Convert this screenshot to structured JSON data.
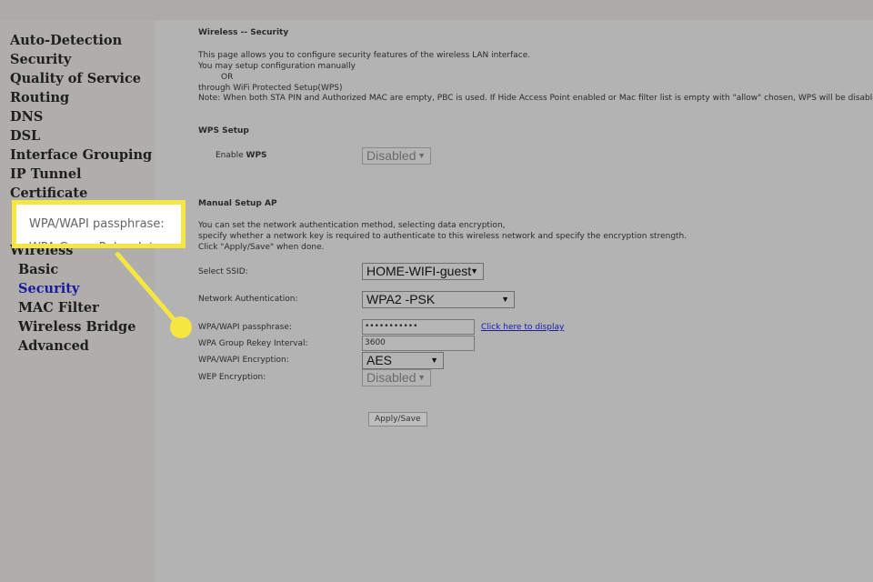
{
  "sidebar": {
    "items": [
      "Auto-Detection",
      "Security",
      "Quality of Service",
      "Routing",
      "DNS",
      "DSL",
      "Interface Grouping",
      "IP Tunnel",
      "Certificate",
      "Wireless"
    ],
    "subitems": [
      "Basic",
      "Security",
      "MAC Filter",
      "Wireless Bridge",
      "Advanced"
    ],
    "active": "Security"
  },
  "main": {
    "title": "Wireless -- Security",
    "intro": [
      "This page allows you to configure security features of the wireless LAN interface.",
      "You may setup configuration manually",
      "OR",
      "through WiFi Protected Setup(WPS)",
      "Note: When both STA PIN and Authorized MAC are empty, PBC is used. If Hide Access Point enabled or Mac filter list is empty with \"allow\" chosen, WPS will be disabled"
    ],
    "wps": {
      "heading": "WPS Setup",
      "label_prefix": "Enable ",
      "label_bold": "WPS",
      "value": "Disabled"
    },
    "manual": {
      "heading": "Manual Setup AP",
      "desc": [
        "You can set the network authentication method, selecting data encryption,",
        "specify whether a network key is required to authenticate to this wireless network and specify the encryption strength.",
        "Click \"Apply/Save\" when done."
      ],
      "ssid_label": "Select SSID:",
      "ssid_value": "HOME-WIFI-guest",
      "auth_label": "Network Authentication:",
      "auth_value": "WPA2 -PSK",
      "pass_label": "WPA/WAPI passphrase:",
      "pass_value": "•••••••••••",
      "pass_link": "Click here to display",
      "rekey_label": "WPA Group Rekey Interval:",
      "rekey_value": "3600",
      "enc_label": "WPA/WAPI Encryption:",
      "enc_value": "AES",
      "wep_label": "WEP Encryption:",
      "wep_value": "Disabled",
      "apply": "Apply/Save"
    }
  },
  "callout": {
    "line1": "WPA/WAPI passphrase:",
    "line2": "WPA Group Rekey Interval:",
    "color": "#f5e642"
  }
}
